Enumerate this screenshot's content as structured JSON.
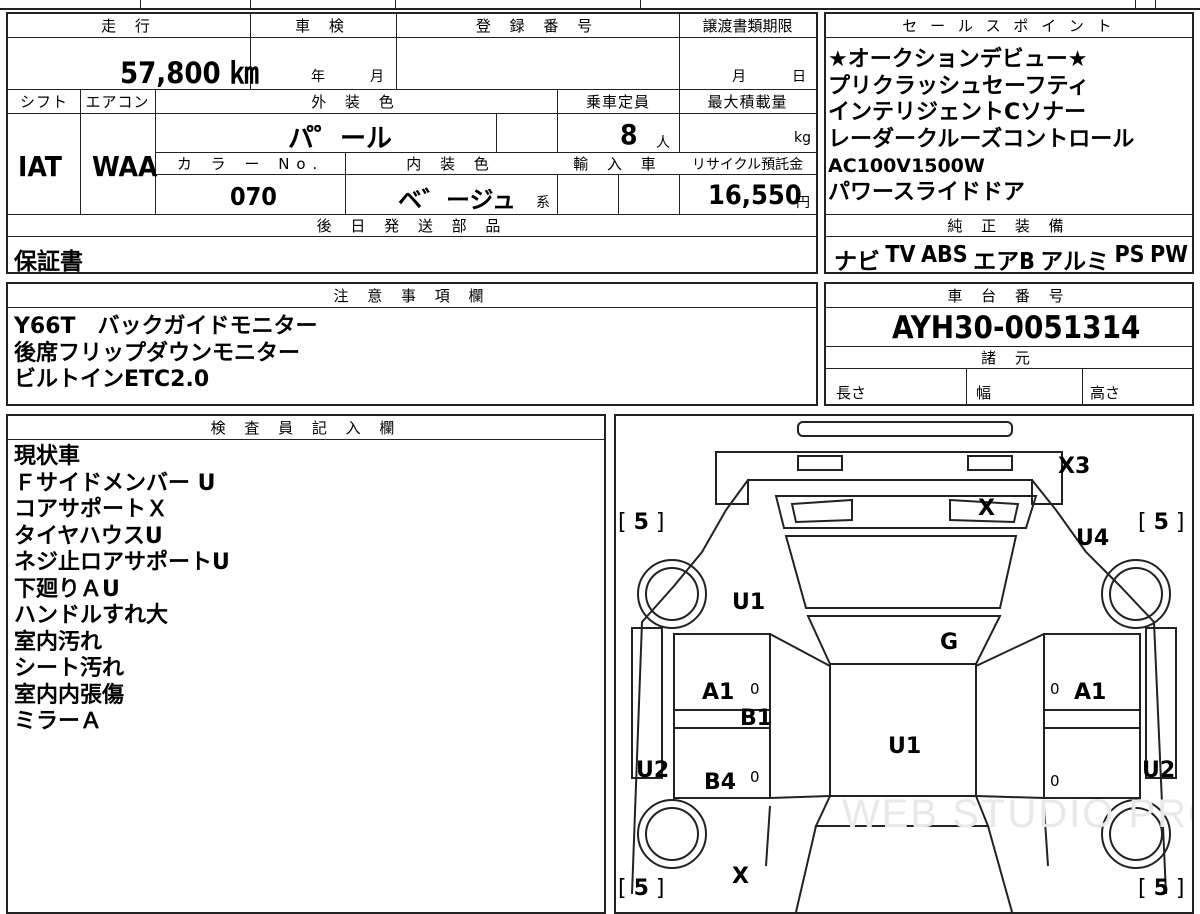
{
  "headers": {
    "mileage": "走 行",
    "inspection": "車 検",
    "registration_number": "登 録 番 号",
    "transfer_deadline": "譲渡書類期限",
    "shift": "シフト",
    "aircon": "エアコン",
    "exterior_color": "外 装 色",
    "capacity": "乗車定員",
    "max_load": "最大積載量",
    "color_no": "カ ラ ー No.",
    "interior_color": "内 装 色",
    "import_car": "輸 入 車",
    "recycle_fee": "リサイクル預託金",
    "deferred_parts": "後 日 発 送 部 品",
    "sales_points": "セ ー ル ス ポ イ ン ト",
    "standard_equipment": "純 正 装 備",
    "notes": "注 意 事 項 欄",
    "chassis_number": "車 台 番 号",
    "specs": "諸 元",
    "inspector": "検 査 員 記 入 欄"
  },
  "vehicle": {
    "mileage": "57,800 ㎞",
    "inspection_year_unit": "年",
    "inspection_month_unit": "月",
    "transfer_month_unit": "月",
    "transfer_day_unit": "日",
    "shift": "IAT",
    "aircon": "WAA",
    "exterior_color": "パ゜ール",
    "capacity": "8",
    "capacity_unit": "人",
    "max_load_unit": "kg",
    "color_no": "070",
    "interior_color": "ベ゛ージュ",
    "interior_color_suffix": "系",
    "recycle_fee": "16,550",
    "recycle_fee_unit": "円"
  },
  "deferred_parts": "保証書",
  "sales_points": [
    "★オークションデビュー★",
    "プリクラッシュセーフティ",
    "インテリジェントCソナー",
    "レーダークルーズコントロール",
    "AC100V1500W",
    "パワースライドドア"
  ],
  "standard_equipment": [
    "ナビ",
    "TV",
    "ABS",
    "エアB",
    "アルミ",
    "PS",
    "PW"
  ],
  "notes": [
    "Y66T　バックガイドモニター",
    "後席フリップダウンモニター",
    "ビルトインETC2.0"
  ],
  "chassis_number": "AYH30-0051314",
  "specs": {
    "length": "長さ",
    "width": "幅",
    "height": "高さ"
  },
  "inspector_notes": [
    "現状車",
    "Ｆサイドメンバー U",
    "コアサポートＸ",
    "タイヤハウスU",
    "ネジ止ロアサポートU",
    "下廻りＡU",
    "ハンドルすれ大",
    "室内汚れ",
    "シート汚れ",
    "室内内張傷",
    "ミラーＡ"
  ],
  "diagram": {
    "tire_tread": "5",
    "marks": {
      "rear_bumper": "X3",
      "rear_glass": "X",
      "rear_right_quarter": "U4",
      "rear_left_quarter": "U1",
      "roof_rear": "G",
      "left_rear_door": "A1",
      "left_front_door": "B1",
      "right_door": "A1",
      "hood": "U1",
      "left_rocker": "U2",
      "left_front_door_lower": "B4",
      "right_rocker": "U2",
      "front_bumper": "X"
    },
    "zero": "0"
  },
  "watermark": "WEB STUDIO PRO"
}
